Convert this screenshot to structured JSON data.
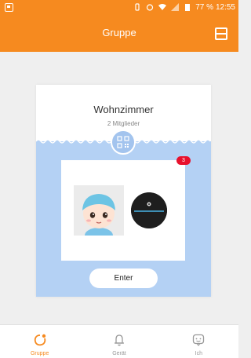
{
  "status_bar": {
    "battery": "77 %",
    "time": "12:55"
  },
  "header": {
    "title": "Gruppe"
  },
  "group_card": {
    "room_name": "Wohnzimmer",
    "member_count": "2 Mitglieder",
    "badge_count": "3",
    "enter_label": "Enter"
  },
  "tabs": [
    {
      "label": "Gruppe",
      "icon": "group-icon",
      "active": true
    },
    {
      "label": "Gerät",
      "icon": "bell-icon",
      "active": false
    },
    {
      "label": "Ich",
      "icon": "chat-face-icon",
      "active": false
    }
  ],
  "colors": {
    "accent": "#f68a1f",
    "card_blue": "#b4d1f4",
    "badge": "#e8112d"
  }
}
